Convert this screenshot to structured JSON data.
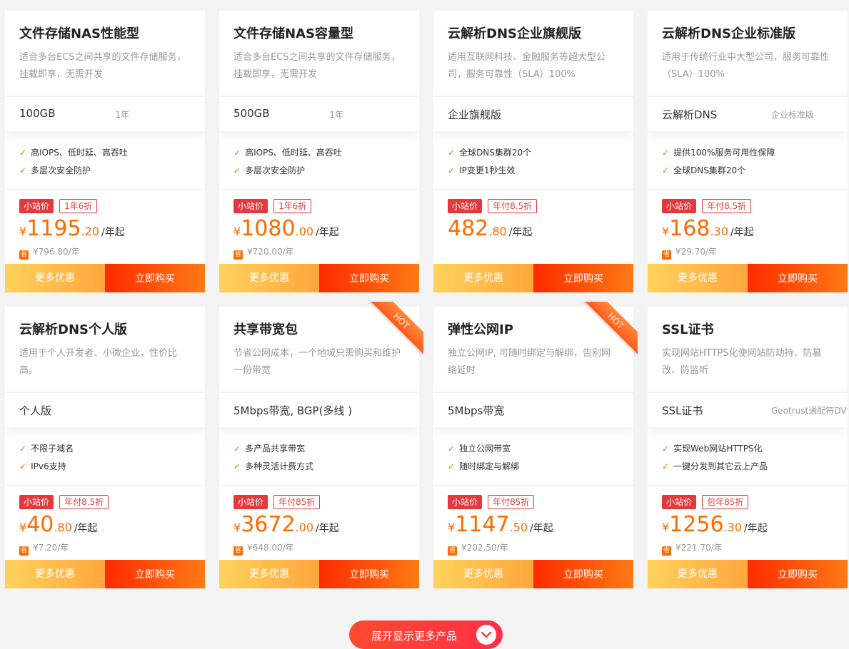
{
  "cards": [
    {
      "name": "文件存储NAS性能型",
      "desc": "适合多台ECS之间共享的文件存储服务，挂载即享，无需开发",
      "spec": "100GB",
      "spec_sub": "1年",
      "features": [
        "高IOPS、低时延、高吞吐",
        "多层次安全防护"
      ],
      "tag": "小站价",
      "discount": "1年6折",
      "currency": "¥",
      "price_int": "1195",
      "price_dec": ".20",
      "unit": "/年起",
      "orig": "¥796.80/年",
      "save_icon": "省",
      "more": "更多优惠",
      "buy": "立即购买",
      "hot": false
    },
    {
      "name": "文件存储NAS容量型",
      "desc": "适合多台ECS之间共享的文件存储服务，挂载即享，无需开发",
      "spec": "500GB",
      "spec_sub": "1年",
      "features": [
        "高IOPS、低时延、高吞吐",
        "多层次安全防护"
      ],
      "tag": "小站价",
      "discount": "1年6折",
      "currency": "¥",
      "price_int": "1080",
      "price_dec": ".00",
      "unit": "/年起",
      "orig": "¥720.00/年",
      "save_icon": "省",
      "more": "更多优惠",
      "buy": "立即购买",
      "hot": false
    },
    {
      "name": "云解析DNS企业旗舰版",
      "desc": "适用互联网科技、金融服务等超大型公司，服务可靠性（SLA）100%",
      "spec": "企业旗舰版",
      "spec_sub": "",
      "features": [
        "全球DNS集群20个",
        "IP变更1秒生效"
      ],
      "tag": "小站价",
      "discount": "年付8.5折",
      "currency": "",
      "price_int": "482",
      "price_dec": ".80",
      "unit": "/年起",
      "orig": "",
      "save_icon": "",
      "more": "更多优惠",
      "buy": "立即购买",
      "hot": false
    },
    {
      "name": "云解析DNS企业标准版",
      "desc": "适用于传统行业中大型公司，服务可靠性（SLA）100%",
      "spec": "云解析DNS",
      "spec_sub": "企业标准版",
      "features": [
        "提供100%服务可用性保障",
        "全球DNS集群20个"
      ],
      "tag": "小站价",
      "discount": "年付8.5折",
      "currency": "¥",
      "price_int": "168",
      "price_dec": ".30",
      "unit": "/年起",
      "orig": "¥29.70/年",
      "save_icon": "省",
      "more": "更多优惠",
      "buy": "立即购买",
      "hot": false
    },
    {
      "name": "云解析DNS个人版",
      "desc": "适用于个人开发者、小微企业，性价比高。",
      "spec": "个人版",
      "spec_sub": "",
      "features": [
        "不限子域名",
        "IPv6支持"
      ],
      "tag": "小站价",
      "discount": "年付8.5折",
      "currency": "¥",
      "price_int": "40",
      "price_dec": ".80",
      "unit": "/年起",
      "orig": "¥7.20/年",
      "save_icon": "省",
      "more": "更多优惠",
      "buy": "立即购买",
      "hot": false
    },
    {
      "name": "共享带宽包",
      "desc": "节省公网成本，一个地域只需购买和维护一份带宽",
      "spec": "5Mbps带宽, BGP(多线 )",
      "spec_sub": "",
      "features": [
        "多产品共享带宽",
        "多种灵活计费方式"
      ],
      "tag": "小站价",
      "discount": "年付85折",
      "currency": "¥",
      "price_int": "3672",
      "price_dec": ".00",
      "unit": "/年起",
      "orig": "¥648.00/年",
      "save_icon": "省",
      "more": "更多优惠",
      "buy": "立即购买",
      "hot": true
    },
    {
      "name": "弹性公网IP",
      "desc": "独立公网IP, 可随时绑定与解绑，告别网络延时",
      "spec": "5Mbps带宽",
      "spec_sub": "",
      "features": [
        "独立公网带宽",
        "随时绑定与解绑"
      ],
      "tag": "小站价",
      "discount": "年付85折",
      "currency": "¥",
      "price_int": "1147",
      "price_dec": ".50",
      "unit": "/年起",
      "orig": "¥202.50/年",
      "save_icon": "省",
      "more": "更多优惠",
      "buy": "立即购买",
      "hot": true
    },
    {
      "name": "SSL证书",
      "desc": "实现网站HTTPS化使网站防劫持、防篡改、防监听",
      "spec": "SSL证书",
      "spec_sub": "Geotrust通配符DV",
      "features": [
        "实现Web网站HTTPS化",
        "一键分发到其它云上产品"
      ],
      "tag": "小站价",
      "discount": "包年85折",
      "currency": "¥",
      "price_int": "1256",
      "price_dec": ".30",
      "unit": "/年起",
      "orig": "¥221.70/年",
      "save_icon": "省",
      "more": "更多优惠",
      "buy": "立即购买",
      "hot": false
    }
  ],
  "hot_label": "HOT",
  "expand_label": "展开显示更多产品",
  "check_icon": "check-icon",
  "colors": {
    "accent": "#ff6a00",
    "tag_red": "#e4393c",
    "buy_start": "#ff2b00",
    "more_start": "#ffd25c"
  }
}
